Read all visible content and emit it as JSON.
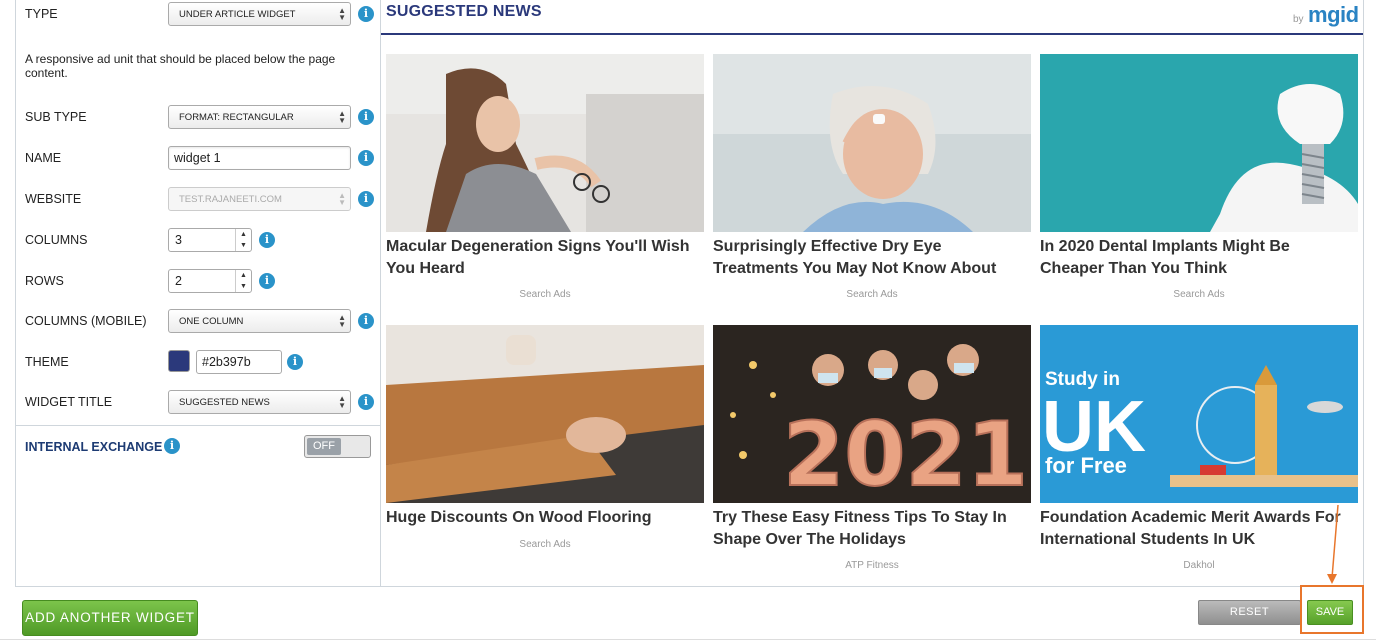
{
  "form": {
    "type": {
      "label": "TYPE",
      "value": "UNDER ARTICLE WIDGET"
    },
    "type_description": "A responsive ad unit that should be placed below the page content.",
    "sub_type": {
      "label": "SUB TYPE",
      "value": "FORMAT: RECTANGULAR"
    },
    "name": {
      "label": "NAME",
      "value": "widget 1"
    },
    "website": {
      "label": "WEBSITE",
      "value": "TEST.RAJANEETI.COM"
    },
    "columns": {
      "label": "COLUMNS",
      "value": "3"
    },
    "rows": {
      "label": "ROWS",
      "value": "2"
    },
    "columns_mobile": {
      "label": "COLUMNS (MOBILE)",
      "value": "ONE COLUMN"
    },
    "theme": {
      "label": "THEME",
      "value": "#2b397b",
      "color": "#2b397b"
    },
    "widget_title": {
      "label": "WIDGET TITLE",
      "value": "SUGGESTED NEWS"
    },
    "internal_exchange": {
      "label": "INTERNAL EXCHANGE",
      "toggle": "OFF"
    },
    "info_glyph": "i"
  },
  "preview": {
    "title": "SUGGESTED NEWS",
    "brand_by": "by",
    "brand_name": "mgid",
    "cards": [
      {
        "title": "Macular Degeneration Signs You'll Wish You Heard",
        "source": "Search Ads"
      },
      {
        "title": "Surprisingly Effective Dry Eye Treatments You May Not Know About",
        "source": "Search Ads"
      },
      {
        "title": "In 2020 Dental Implants Might Be Cheaper Than You Think",
        "source": "Search Ads"
      },
      {
        "title": "Huge Discounts On Wood Flooring",
        "source": "Search Ads"
      },
      {
        "title": "Try These Easy Fitness Tips To Stay In Shape Over The Holidays",
        "source": "ATP Fitness"
      },
      {
        "title": "Foundation Academic Merit Awards For International Students In UK",
        "source": "Dakhol"
      }
    ],
    "ad_image_text": {
      "line1": "Study in",
      "line2": "UK",
      "line3": "for Free"
    },
    "balloon_text": "2021"
  },
  "actions": {
    "add_widget": "ADD ANOTHER WIDGET",
    "reset": "RESET",
    "save": "SAVE"
  },
  "colors": {
    "accent": "#2b397b",
    "info": "#2a93c9",
    "save": "#5fae2e",
    "highlight": "#e8762c"
  }
}
